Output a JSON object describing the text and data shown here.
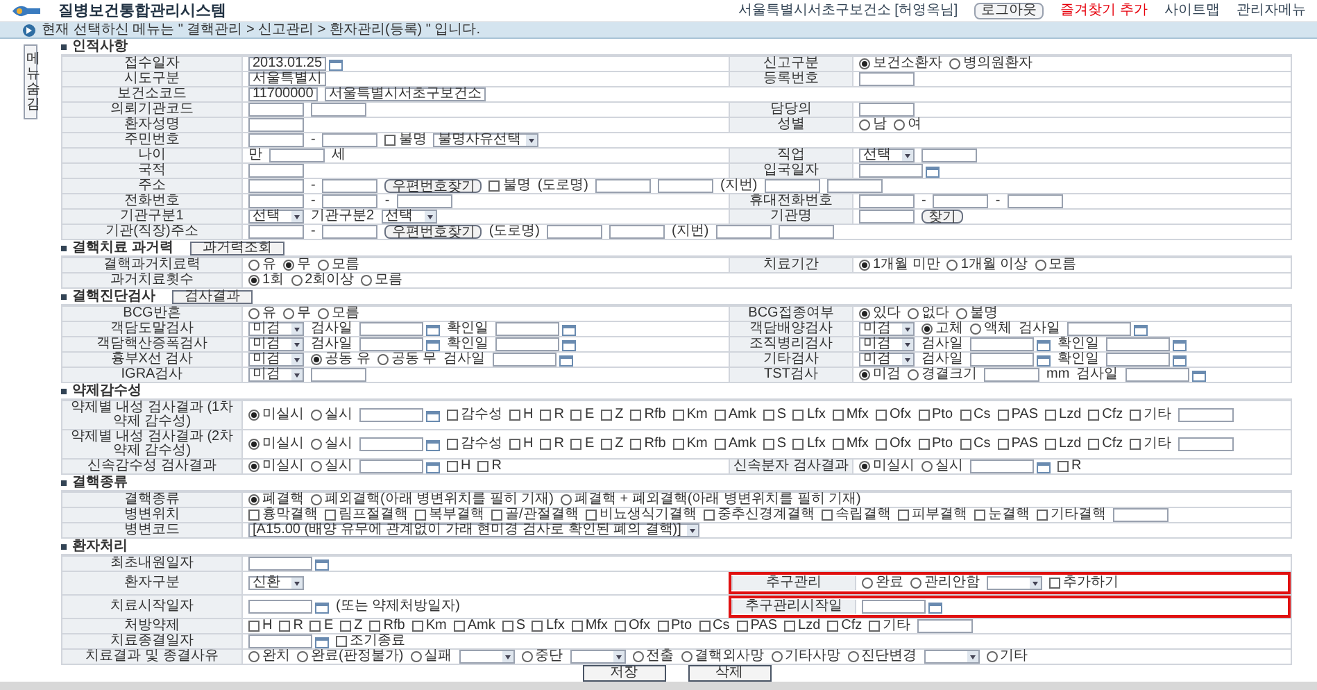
{
  "header": {
    "title": "질병보건통합관리시스템",
    "office_user": "서울특별시서초구보건소 [허영옥님]",
    "links": [
      "로그아웃",
      "즐겨찾기 추가",
      "사이트맵",
      "관리자메뉴"
    ]
  },
  "breadcrumb": "현재 선택하신 메뉴는 \" 결핵관리 > 신고관리 > 환자관리(등록) \" 입니다.",
  "side_tab": "메뉴숨김",
  "sections": [
    {
      "title": "인적사항",
      "rows": [
        {
          "label": "접수일자",
          "items": [
            {
              "kind": "date",
              "value": "2013.01.25"
            }
          ],
          "right": {
            "label": "신고구분",
            "items": [
              {
                "kind": "radio",
                "label": "보건소환자",
                "selected": true
              },
              {
                "kind": "radio",
                "label": "병의원환자",
                "selected": false
              }
            ]
          }
        },
        {
          "label": "시도구분",
          "items": [
            {
              "kind": "field",
              "value": "서울특별시"
            }
          ],
          "right": {
            "label": "등록번호",
            "items": [
              {
                "kind": "field"
              }
            ]
          }
        },
        {
          "label": "보건소코드",
          "items": [
            {
              "kind": "field",
              "value": "11700000"
            },
            {
              "kind": "field",
              "value": "서울특별시서초구보건소"
            }
          ]
        },
        {
          "label": "의뢰기관코드",
          "items": [
            {
              "kind": "field"
            },
            {
              "kind": "field"
            }
          ],
          "right": {
            "label": "담당의",
            "items": [
              {
                "kind": "field"
              }
            ]
          }
        },
        {
          "label": "환자성명",
          "items": [
            {
              "kind": "field"
            }
          ],
          "right": {
            "label": "성별",
            "items": [
              {
                "kind": "radio",
                "label": "남",
                "selected": false
              },
              {
                "kind": "radio",
                "label": "여",
                "selected": false
              }
            ]
          }
        },
        {
          "label": "주민번호",
          "items": [
            {
              "kind": "field"
            },
            {
              "kind": "text",
              "text": "-"
            },
            {
              "kind": "field"
            },
            {
              "kind": "check",
              "label": "불명",
              "checked": false
            },
            {
              "kind": "select",
              "value": "불명사유선택"
            }
          ]
        },
        {
          "label": "나이",
          "items": [
            {
              "kind": "text",
              "text": "만"
            },
            {
              "kind": "field"
            },
            {
              "kind": "text",
              "text": "세"
            }
          ],
          "right": {
            "label": "직업",
            "items": [
              {
                "kind": "select",
                "value": "선택"
              },
              {
                "kind": "field"
              }
            ]
          }
        },
        {
          "label": "국적",
          "items": [
            {
              "kind": "field"
            }
          ],
          "right": {
            "label": "입국일자",
            "items": [
              {
                "kind": "date"
              }
            ]
          }
        },
        {
          "label": "주소",
          "items": [
            {
              "kind": "field"
            },
            {
              "kind": "text",
              "text": "-"
            },
            {
              "kind": "field"
            },
            {
              "kind": "button",
              "label": "우편번호찾기"
            },
            {
              "kind": "check",
              "label": "불명",
              "checked": false
            },
            {
              "kind": "text",
              "text": "(도로명)"
            },
            {
              "kind": "field"
            },
            {
              "kind": "field"
            },
            {
              "kind": "text",
              "text": "(지번)"
            },
            {
              "kind": "field"
            },
            {
              "kind": "field"
            }
          ]
        },
        {
          "label": "전화번호",
          "items": [
            {
              "kind": "field"
            },
            {
              "kind": "text",
              "text": "-"
            },
            {
              "kind": "field"
            },
            {
              "kind": "text",
              "text": "-"
            },
            {
              "kind": "field"
            }
          ],
          "right": {
            "label": "휴대전화번호",
            "items": [
              {
                "kind": "field"
              },
              {
                "kind": "text",
                "text": "-"
              },
              {
                "kind": "field"
              },
              {
                "kind": "text",
                "text": "-"
              },
              {
                "kind": "field"
              }
            ]
          }
        },
        {
          "label": "기관구분1",
          "items": [
            {
              "kind": "select",
              "value": "선택"
            },
            {
              "kind": "text",
              "text": "기관구분2"
            },
            {
              "kind": "select",
              "value": "선택"
            }
          ],
          "right": {
            "label": "기관명",
            "items": [
              {
                "kind": "field"
              },
              {
                "kind": "button",
                "label": "찾기"
              }
            ]
          }
        },
        {
          "label": "기관(직장)주소",
          "items": [
            {
              "kind": "field"
            },
            {
              "kind": "text",
              "text": "-"
            },
            {
              "kind": "field"
            },
            {
              "kind": "button",
              "label": "우편번호찾기"
            },
            {
              "kind": "text",
              "text": "(도로명)"
            },
            {
              "kind": "field"
            },
            {
              "kind": "field"
            },
            {
              "kind": "text",
              "text": "(지번)"
            },
            {
              "kind": "field"
            },
            {
              "kind": "field"
            }
          ]
        }
      ]
    },
    {
      "title": "결핵치료 과거력",
      "button": "과거력조회",
      "rows": [
        {
          "label": "결핵과거치료력",
          "items": [
            {
              "kind": "radio",
              "label": "유",
              "selected": false
            },
            {
              "kind": "radio",
              "label": "무",
              "selected": true
            },
            {
              "kind": "radio",
              "label": "모름",
              "selected": false
            }
          ],
          "right": {
            "label": "치료기간",
            "items": [
              {
                "kind": "radio",
                "label": "1개월 미만",
                "selected": true
              },
              {
                "kind": "radio",
                "label": "1개월 이상",
                "selected": false
              },
              {
                "kind": "radio",
                "label": "모름",
                "selected": false
              }
            ]
          }
        },
        {
          "label": "과거치료횟수",
          "items": [
            {
              "kind": "radio",
              "label": "1회",
              "selected": true
            },
            {
              "kind": "radio",
              "label": "2회이상",
              "selected": false
            },
            {
              "kind": "radio",
              "label": "모름",
              "selected": false
            }
          ]
        }
      ]
    },
    {
      "title": "결핵진단검사",
      "button": "검사결과",
      "rows": [
        {
          "label": "BCG반흔",
          "items": [
            {
              "kind": "radio",
              "label": "유",
              "selected": false
            },
            {
              "kind": "radio",
              "label": "무",
              "selected": false
            },
            {
              "kind": "radio",
              "label": "모름",
              "selected": false
            }
          ],
          "right": {
            "label": "BCG접종여부",
            "items": [
              {
                "kind": "radio",
                "label": "있다",
                "selected": true
              },
              {
                "kind": "radio",
                "label": "없다",
                "selected": false
              },
              {
                "kind": "radio",
                "label": "불명",
                "selected": false
              }
            ]
          }
        },
        {
          "label": "객담도말검사",
          "items": [
            {
              "kind": "select",
              "value": "미검"
            },
            {
              "kind": "text",
              "text": "검사일"
            },
            {
              "kind": "date"
            },
            {
              "kind": "text",
              "text": "확인일"
            },
            {
              "kind": "date"
            }
          ],
          "right": {
            "label": "객담배양검사",
            "items": [
              {
                "kind": "select",
                "value": "미검"
              },
              {
                "kind": "radio",
                "label": "고체",
                "selected": true
              },
              {
                "kind": "radio",
                "label": "액체",
                "selected": false
              },
              {
                "kind": "text",
                "text": "검사일"
              },
              {
                "kind": "date"
              }
            ]
          }
        },
        {
          "label": "객담핵산증폭검사",
          "items": [
            {
              "kind": "select",
              "value": "미검"
            },
            {
              "kind": "text",
              "text": "검사일"
            },
            {
              "kind": "date"
            },
            {
              "kind": "text",
              "text": "확인일"
            },
            {
              "kind": "date"
            }
          ],
          "right": {
            "label": "조직병리검사",
            "items": [
              {
                "kind": "select",
                "value": "미검"
              },
              {
                "kind": "text",
                "text": "검사일"
              },
              {
                "kind": "date"
              },
              {
                "kind": "text",
                "text": "확인일"
              },
              {
                "kind": "date"
              }
            ]
          }
        },
        {
          "label": "흉부X선 검사",
          "items": [
            {
              "kind": "select",
              "value": "미검"
            },
            {
              "kind": "radio",
              "label": "공동 유",
              "selected": true
            },
            {
              "kind": "radio",
              "label": "공동 무",
              "selected": false
            },
            {
              "kind": "text",
              "text": "검사일"
            },
            {
              "kind": "date"
            }
          ],
          "right": {
            "label": "기타검사",
            "items": [
              {
                "kind": "select",
                "value": "미검"
              },
              {
                "kind": "text",
                "text": "검사일"
              },
              {
                "kind": "date"
              },
              {
                "kind": "text",
                "text": "확인일"
              },
              {
                "kind": "date"
              }
            ]
          }
        },
        {
          "label": "IGRA검사",
          "items": [
            {
              "kind": "select",
              "value": "미검"
            },
            {
              "kind": "field"
            }
          ],
          "right": {
            "label": "TST검사",
            "items": [
              {
                "kind": "radio",
                "label": "미검",
                "selected": true
              },
              {
                "kind": "radio",
                "label": "경결크기",
                "selected": false
              },
              {
                "kind": "field"
              },
              {
                "kind": "text",
                "text": "mm"
              },
              {
                "kind": "text",
                "text": "검사일"
              },
              {
                "kind": "date"
              }
            ]
          }
        }
      ]
    },
    {
      "title": "약제감수성",
      "rows": [
        {
          "label": "약제별 내성 검사결과 (1차 약제 감수성)",
          "items": [
            {
              "kind": "radio",
              "label": "미실시",
              "selected": true
            },
            {
              "kind": "radio",
              "label": "실시",
              "selected": false
            },
            {
              "kind": "date"
            },
            {
              "kind": "check",
              "label": "감수성",
              "checked": false
            },
            {
              "kind": "check",
              "label": "H",
              "checked": false
            },
            {
              "kind": "check",
              "label": "R",
              "checked": false
            },
            {
              "kind": "check",
              "label": "E",
              "checked": false
            },
            {
              "kind": "check",
              "label": "Z",
              "checked": false
            },
            {
              "kind": "check",
              "label": "Rfb",
              "checked": false
            },
            {
              "kind": "check",
              "label": "Km",
              "checked": false
            },
            {
              "kind": "check",
              "label": "Amk",
              "checked": false
            },
            {
              "kind": "check",
              "label": "S",
              "checked": false
            },
            {
              "kind": "check",
              "label": "Lfx",
              "checked": false
            },
            {
              "kind": "check",
              "label": "Mfx",
              "checked": false
            },
            {
              "kind": "check",
              "label": "Ofx",
              "checked": false
            },
            {
              "kind": "check",
              "label": "Pto",
              "checked": false
            },
            {
              "kind": "check",
              "label": "Cs",
              "checked": false
            },
            {
              "kind": "check",
              "label": "PAS",
              "checked": false
            },
            {
              "kind": "check",
              "label": "Lzd",
              "checked": false
            },
            {
              "kind": "check",
              "label": "Cfz",
              "checked": false
            },
            {
              "kind": "check",
              "label": "기타",
              "checked": false
            },
            {
              "kind": "field"
            }
          ]
        },
        {
          "label": "약제별 내성 검사결과 (2차 약제 감수성)",
          "items": [
            {
              "kind": "radio",
              "label": "미실시",
              "selected": true
            },
            {
              "kind": "radio",
              "label": "실시",
              "selected": false
            },
            {
              "kind": "date"
            },
            {
              "kind": "check",
              "label": "감수성",
              "checked": false
            },
            {
              "kind": "check",
              "label": "H",
              "checked": false
            },
            {
              "kind": "check",
              "label": "R",
              "checked": false
            },
            {
              "kind": "check",
              "label": "E",
              "checked": false
            },
            {
              "kind": "check",
              "label": "Z",
              "checked": false
            },
            {
              "kind": "check",
              "label": "Rfb",
              "checked": false
            },
            {
              "kind": "check",
              "label": "Km",
              "checked": false
            },
            {
              "kind": "check",
              "label": "Amk",
              "checked": false
            },
            {
              "kind": "check",
              "label": "S",
              "checked": false
            },
            {
              "kind": "check",
              "label": "Lfx",
              "checked": false
            },
            {
              "kind": "check",
              "label": "Mfx",
              "checked": false
            },
            {
              "kind": "check",
              "label": "Ofx",
              "checked": false
            },
            {
              "kind": "check",
              "label": "Pto",
              "checked": false
            },
            {
              "kind": "check",
              "label": "Cs",
              "checked": false
            },
            {
              "kind": "check",
              "label": "PAS",
              "checked": false
            },
            {
              "kind": "check",
              "label": "Lzd",
              "checked": false
            },
            {
              "kind": "check",
              "label": "Cfz",
              "checked": false
            },
            {
              "kind": "check",
              "label": "기타",
              "checked": false
            },
            {
              "kind": "field"
            }
          ]
        },
        {
          "label": "신속감수성 검사결과",
          "items": [
            {
              "kind": "radio",
              "label": "미실시",
              "selected": true
            },
            {
              "kind": "radio",
              "label": "실시",
              "selected": false
            },
            {
              "kind": "date"
            },
            {
              "kind": "check",
              "label": "H",
              "checked": false
            },
            {
              "kind": "check",
              "label": "R",
              "checked": false
            }
          ],
          "right": {
            "label": "신속분자 검사결과",
            "items": [
              {
                "kind": "radio",
                "label": "미실시",
                "selected": true
              },
              {
                "kind": "radio",
                "label": "실시",
                "selected": false
              },
              {
                "kind": "date"
              },
              {
                "kind": "check",
                "label": "R",
                "checked": false
              }
            ]
          }
        }
      ]
    },
    {
      "title": "결핵종류",
      "rows": [
        {
          "label": "결핵종류",
          "items": [
            {
              "kind": "radio",
              "label": "폐결핵",
              "selected": true
            },
            {
              "kind": "radio",
              "label": "폐외결핵(아래 병변위치를 필히 기재)",
              "selected": false
            },
            {
              "kind": "radio",
              "label": "폐결핵 + 폐외결핵(아래 병변위치를 필히 기재)",
              "selected": false
            }
          ]
        },
        {
          "label": "병변위치",
          "items": [
            {
              "kind": "check",
              "label": "흉막결핵",
              "checked": false
            },
            {
              "kind": "check",
              "label": "림프절결핵",
              "checked": false
            },
            {
              "kind": "check",
              "label": "복부결핵",
              "checked": false
            },
            {
              "kind": "check",
              "label": "골/관절결핵",
              "checked": false
            },
            {
              "kind": "check",
              "label": "비뇨생식기결핵",
              "checked": false
            },
            {
              "kind": "check",
              "label": "중추신경계결핵",
              "checked": false
            },
            {
              "kind": "check",
              "label": "속립결핵",
              "checked": false
            },
            {
              "kind": "check",
              "label": "피부결핵",
              "checked": false
            },
            {
              "kind": "check",
              "label": "눈결핵",
              "checked": false
            },
            {
              "kind": "check",
              "label": "기타결핵",
              "checked": false
            },
            {
              "kind": "field"
            }
          ]
        },
        {
          "label": "병변코드",
          "items": [
            {
              "kind": "select",
              "value": "[A15.00 (배양 유무에 관계없이 가래 현미경 검사로 확인된 폐의 결핵)]"
            }
          ]
        }
      ]
    },
    {
      "title": "환자처리",
      "rows": [
        {
          "label": "최초내원일자",
          "items": [
            {
              "kind": "date"
            }
          ]
        },
        {
          "label": "환자구분",
          "items": [
            {
              "kind": "select",
              "value": "신환"
            }
          ],
          "right": {
            "label": "추구관리",
            "highlighted": true,
            "items": [
              {
                "kind": "radio",
                "label": "완료",
                "selected": false
              },
              {
                "kind": "radio",
                "label": "관리안함",
                "selected": false
              },
              {
                "kind": "select"
              },
              {
                "kind": "check",
                "label": "추가하기",
                "checked": false
              }
            ]
          }
        },
        {
          "label": "치료시작일자",
          "items": [
            {
              "kind": "date"
            },
            {
              "kind": "text",
              "text": "(또는 약제처방일자)"
            }
          ],
          "right": {
            "label": "추구관리시작일",
            "highlighted": true,
            "items": [
              {
                "kind": "date"
              }
            ]
          }
        },
        {
          "label": "처방약제",
          "items": [
            {
              "kind": "check",
              "label": "H",
              "checked": false
            },
            {
              "kind": "check",
              "label": "R",
              "checked": false
            },
            {
              "kind": "check",
              "label": "E",
              "checked": false
            },
            {
              "kind": "check",
              "label": "Z",
              "checked": false
            },
            {
              "kind": "check",
              "label": "Rfb",
              "checked": false
            },
            {
              "kind": "check",
              "label": "Km",
              "checked": false
            },
            {
              "kind": "check",
              "label": "Amk",
              "checked": false
            },
            {
              "kind": "check",
              "label": "S",
              "checked": false
            },
            {
              "kind": "check",
              "label": "Lfx",
              "checked": false
            },
            {
              "kind": "check",
              "label": "Mfx",
              "checked": false
            },
            {
              "kind": "check",
              "label": "Ofx",
              "checked": false
            },
            {
              "kind": "check",
              "label": "Pto",
              "checked": false
            },
            {
              "kind": "check",
              "label": "Cs",
              "checked": false
            },
            {
              "kind": "check",
              "label": "PAS",
              "checked": false
            },
            {
              "kind": "check",
              "label": "Lzd",
              "checked": false
            },
            {
              "kind": "check",
              "label": "Cfz",
              "checked": false
            },
            {
              "kind": "check",
              "label": "기타",
              "checked": false
            },
            {
              "kind": "field"
            }
          ]
        },
        {
          "label": "치료종결일자",
          "items": [
            {
              "kind": "date"
            },
            {
              "kind": "check",
              "label": "조기종료",
              "checked": false
            }
          ]
        },
        {
          "label": "치료결과 및 종결사유",
          "items": [
            {
              "kind": "radio",
              "label": "완치",
              "selected": false
            },
            {
              "kind": "radio",
              "label": "완료(판정불가)",
              "selected": false
            },
            {
              "kind": "radio",
              "label": "실패",
              "selected": false
            },
            {
              "kind": "select"
            },
            {
              "kind": "radio",
              "label": "중단",
              "selected": false
            },
            {
              "kind": "select"
            },
            {
              "kind": "radio",
              "label": "전출",
              "selected": false
            },
            {
              "kind": "radio",
              "label": "결핵외사망",
              "selected": false
            },
            {
              "kind": "radio",
              "label": "기타사망",
              "selected": false
            },
            {
              "kind": "radio",
              "label": "진단변경",
              "selected": false
            },
            {
              "kind": "select"
            },
            {
              "kind": "radio",
              "label": "기타",
              "selected": false
            }
          ]
        }
      ]
    }
  ],
  "actions": [
    "저장",
    "삭제"
  ]
}
